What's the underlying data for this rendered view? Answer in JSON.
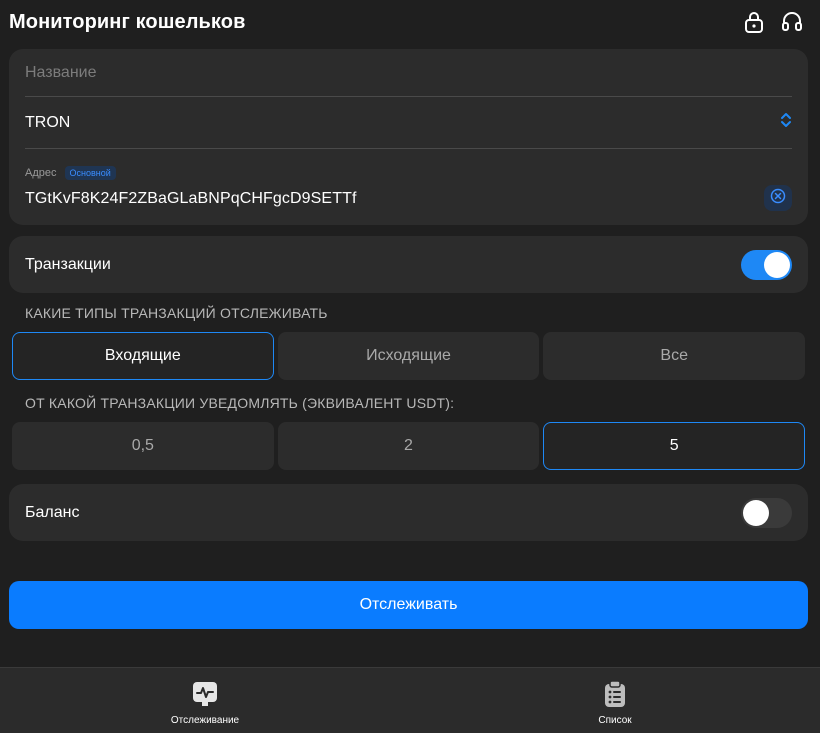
{
  "header": {
    "title": "Мониторинг кошельков",
    "icons": [
      "lock-icon",
      "headset-icon"
    ]
  },
  "form": {
    "name_placeholder": "Название",
    "network_value": "TRON",
    "address_label": "Адрес",
    "address_badge": "Основной",
    "address_value": "TGtKvF8K24F2ZBaGLaBNPqCHFgcD9SETTf"
  },
  "transactions": {
    "label": "Транзакции",
    "enabled": true
  },
  "types_section": {
    "label": "КАКИЕ ТИПЫ ТРАНЗАКЦИЙ ОТСЛЕЖИВАТЬ",
    "options": [
      "Входящие",
      "Исходящие",
      "Все"
    ],
    "selected": "Входящие"
  },
  "amount_section": {
    "label": "ОТ КАКОЙ ТРАНЗАКЦИИ УВЕДОМЛЯТЬ (ЭКВИВАЛЕНТ USDT):",
    "options": [
      "0,5",
      "2",
      "5"
    ],
    "selected": "5"
  },
  "balance": {
    "label": "Баланс",
    "enabled": false
  },
  "submit_label": "Отслеживать",
  "tabbar": {
    "items": [
      {
        "label": "Отслеживание",
        "icon": "monitor-icon"
      },
      {
        "label": "Список",
        "icon": "clipboard-list-icon"
      }
    ]
  },
  "colors": {
    "accent": "#0a7cff",
    "background": "#1f1f1f",
    "card": "#2c2c2c"
  }
}
